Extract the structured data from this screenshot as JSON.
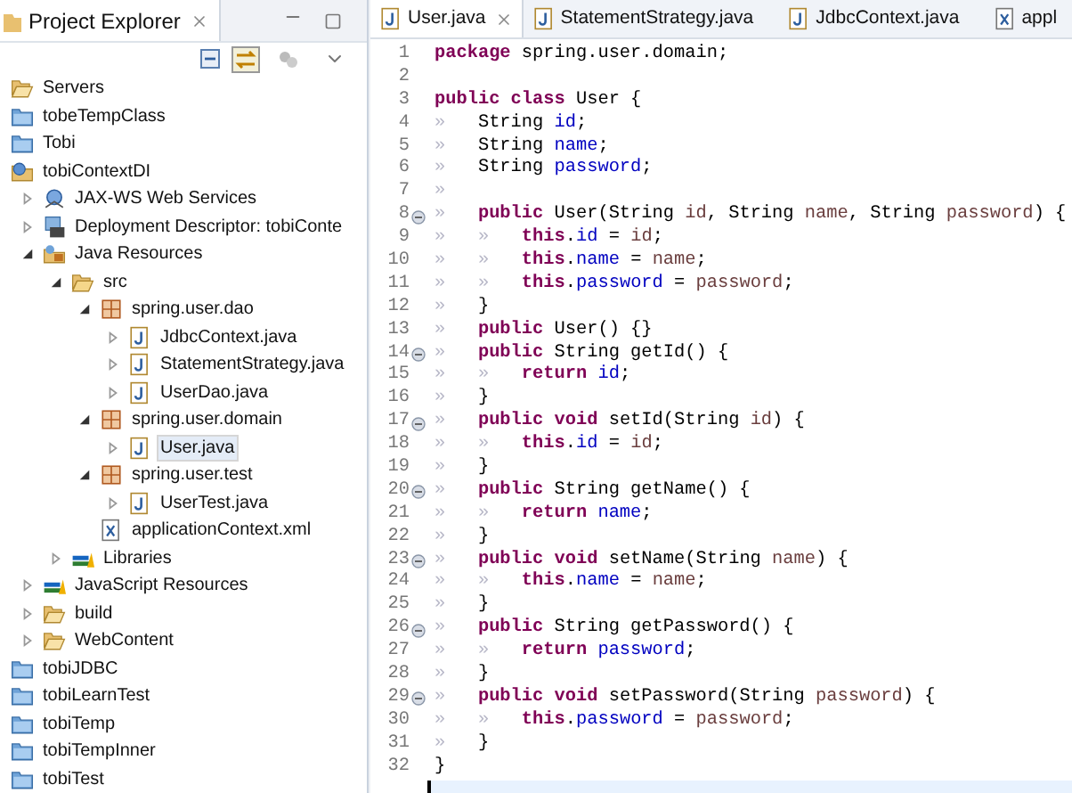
{
  "explorer": {
    "title": "Project Explorer",
    "tree": [
      {
        "label": "Servers",
        "kind": "open-folder"
      },
      {
        "label": "tobeTempClass",
        "kind": "project"
      },
      {
        "label": "Tobi",
        "kind": "project"
      },
      {
        "label": "tobiContextDI",
        "kind": "web-project",
        "children": [
          {
            "label": "JAX-WS Web Services",
            "kind": "web-services",
            "expanded": false
          },
          {
            "label": "Deployment Descriptor: tobiConte",
            "kind": "descriptor",
            "expanded": false
          },
          {
            "label": "Java Resources",
            "kind": "java-resources",
            "expanded": true,
            "children": [
              {
                "label": "src",
                "kind": "source-folder",
                "expanded": true,
                "children": [
                  {
                    "label": "spring.user.dao",
                    "kind": "package",
                    "expanded": true,
                    "children": [
                      {
                        "label": "JdbcContext.java",
                        "kind": "java",
                        "expanded": false,
                        "selected": false
                      },
                      {
                        "label": "StatementStrategy.java",
                        "kind": "java",
                        "expanded": false,
                        "selected": false
                      },
                      {
                        "label": "UserDao.java",
                        "kind": "java",
                        "expanded": false,
                        "selected": false
                      }
                    ]
                  },
                  {
                    "label": "spring.user.domain",
                    "kind": "package",
                    "expanded": true,
                    "children": [
                      {
                        "label": "User.java",
                        "kind": "java",
                        "expanded": false,
                        "selected": true
                      }
                    ]
                  },
                  {
                    "label": "spring.user.test",
                    "kind": "package",
                    "expanded": true,
                    "children": [
                      {
                        "label": "UserTest.java",
                        "kind": "java",
                        "expanded": false,
                        "selected": false
                      }
                    ]
                  },
                  {
                    "label": "applicationContext.xml",
                    "kind": "xml"
                  }
                ]
              },
              {
                "label": "Libraries",
                "kind": "library",
                "expanded": false
              }
            ]
          },
          {
            "label": "JavaScript Resources",
            "kind": "library",
            "expanded": false
          },
          {
            "label": "build",
            "kind": "open-folder",
            "expanded": false
          },
          {
            "label": "WebContent",
            "kind": "open-folder",
            "expanded": false
          }
        ]
      },
      {
        "label": "tobiJDBC",
        "kind": "project"
      },
      {
        "label": "tobiLearnTest",
        "kind": "project"
      },
      {
        "label": "tobiTemp",
        "kind": "project"
      },
      {
        "label": "tobiTempInner",
        "kind": "project"
      },
      {
        "label": "tobiTest",
        "kind": "project"
      }
    ]
  },
  "editor": {
    "tabs": [
      {
        "label": "User.java",
        "kind": "java",
        "selected": true
      },
      {
        "label": "StatementStrategy.java",
        "kind": "java",
        "selected": false
      },
      {
        "label": "JdbcContext.java",
        "kind": "java",
        "selected": false
      },
      {
        "label": "appl",
        "kind": "xml",
        "selected": false
      }
    ],
    "lines": [
      {
        "number": "1",
        "fold": false,
        "tokens": [
          {
            "kind": "keyword",
            "text": "package"
          },
          {
            "kind": "plain",
            "text": " spring.user.domain;"
          }
        ]
      },
      {
        "number": "2",
        "fold": false
      },
      {
        "number": "3",
        "fold": false,
        "tokens": [
          {
            "kind": "keyword",
            "text": "public"
          },
          {
            "kind": "keyword",
            "text": " class"
          },
          {
            "kind": "plain",
            "text": " User {"
          }
        ]
      },
      {
        "number": "4",
        "tabs": [
          "»"
        ],
        "fold": false,
        "tokens": [
          {
            "kind": "plain",
            "text": "String "
          },
          {
            "kind": "field",
            "text": "id"
          },
          {
            "kind": "plain",
            "text": ";"
          }
        ]
      },
      {
        "number": "5",
        "tabs": [
          "»"
        ],
        "fold": false,
        "tokens": [
          {
            "kind": "plain",
            "text": "String "
          },
          {
            "kind": "field",
            "text": "name"
          },
          {
            "kind": "plain",
            "text": ";"
          }
        ]
      },
      {
        "number": "6",
        "tabs": [
          "»"
        ],
        "fold": false,
        "tokens": [
          {
            "kind": "plain",
            "text": "String "
          },
          {
            "kind": "field",
            "text": "password"
          },
          {
            "kind": "plain",
            "text": ";"
          }
        ]
      },
      {
        "number": "7",
        "tabs": [
          "»"
        ],
        "fold": false
      },
      {
        "number": "8",
        "tabs": [
          "»"
        ],
        "fold": true,
        "tokens": [
          {
            "kind": "keyword",
            "text": "public"
          },
          {
            "kind": "plain",
            "text": " User(String "
          },
          {
            "kind": "param",
            "text": "id"
          },
          {
            "kind": "plain",
            "text": ", String "
          },
          {
            "kind": "param",
            "text": "name"
          },
          {
            "kind": "plain",
            "text": ", String "
          },
          {
            "kind": "param",
            "text": "password"
          },
          {
            "kind": "plain",
            "text": ") {"
          }
        ]
      },
      {
        "number": "9",
        "tabs": [
          "»",
          "»"
        ],
        "fold": false,
        "tokens": [
          {
            "kind": "keyword",
            "text": "this"
          },
          {
            "kind": "plain",
            "text": "."
          },
          {
            "kind": "field",
            "text": "id"
          },
          {
            "kind": "plain",
            "text": " = "
          },
          {
            "kind": "param",
            "text": "id"
          },
          {
            "kind": "plain",
            "text": ";"
          }
        ]
      },
      {
        "number": "10",
        "tabs": [
          "»",
          "»"
        ],
        "fold": false,
        "tokens": [
          {
            "kind": "keyword",
            "text": "this"
          },
          {
            "kind": "plain",
            "text": "."
          },
          {
            "kind": "field",
            "text": "name"
          },
          {
            "kind": "plain",
            "text": " = "
          },
          {
            "kind": "param",
            "text": "name"
          },
          {
            "kind": "plain",
            "text": ";"
          }
        ]
      },
      {
        "number": "11",
        "tabs": [
          "»",
          "»"
        ],
        "fold": false,
        "tokens": [
          {
            "kind": "keyword",
            "text": "this"
          },
          {
            "kind": "plain",
            "text": "."
          },
          {
            "kind": "field",
            "text": "password"
          },
          {
            "kind": "plain",
            "text": " = "
          },
          {
            "kind": "param",
            "text": "password"
          },
          {
            "kind": "plain",
            "text": ";"
          }
        ]
      },
      {
        "number": "12",
        "tabs": [
          "»"
        ],
        "fold": false,
        "tokens": [
          {
            "kind": "plain",
            "text": "}"
          }
        ]
      },
      {
        "number": "13",
        "tabs": [
          "»"
        ],
        "fold": false,
        "tokens": [
          {
            "kind": "keyword",
            "text": "public"
          },
          {
            "kind": "plain",
            "text": " User() {}"
          }
        ]
      },
      {
        "number": "14",
        "tabs": [
          "»"
        ],
        "fold": true,
        "tokens": [
          {
            "kind": "keyword",
            "text": "public"
          },
          {
            "kind": "plain",
            "text": " String getId() {"
          }
        ]
      },
      {
        "number": "15",
        "tabs": [
          "»",
          "»"
        ],
        "fold": false,
        "tokens": [
          {
            "kind": "keyword",
            "text": "return"
          },
          {
            "kind": "field",
            "text": " id"
          },
          {
            "kind": "plain",
            "text": ";"
          }
        ]
      },
      {
        "number": "16",
        "tabs": [
          "»"
        ],
        "fold": false,
        "tokens": [
          {
            "kind": "plain",
            "text": "}"
          }
        ]
      },
      {
        "number": "17",
        "tabs": [
          "»"
        ],
        "fold": true,
        "tokens": [
          {
            "kind": "keyword",
            "text": "public"
          },
          {
            "kind": "keyword",
            "text": " void"
          },
          {
            "kind": "plain",
            "text": " setId(String "
          },
          {
            "kind": "param",
            "text": "id"
          },
          {
            "kind": "plain",
            "text": ") {"
          }
        ]
      },
      {
        "number": "18",
        "tabs": [
          "»",
          "»"
        ],
        "fold": false,
        "tokens": [
          {
            "kind": "keyword",
            "text": "this"
          },
          {
            "kind": "plain",
            "text": "."
          },
          {
            "kind": "field",
            "text": "id"
          },
          {
            "kind": "plain",
            "text": " = "
          },
          {
            "kind": "param",
            "text": "id"
          },
          {
            "kind": "plain",
            "text": ";"
          }
        ]
      },
      {
        "number": "19",
        "tabs": [
          "»"
        ],
        "fold": false,
        "tokens": [
          {
            "kind": "plain",
            "text": "}"
          }
        ]
      },
      {
        "number": "20",
        "tabs": [
          "»"
        ],
        "fold": true,
        "tokens": [
          {
            "kind": "keyword",
            "text": "public"
          },
          {
            "kind": "plain",
            "text": " String getName() {"
          }
        ]
      },
      {
        "number": "21",
        "tabs": [
          "»",
          "»"
        ],
        "fold": false,
        "tokens": [
          {
            "kind": "keyword",
            "text": "return"
          },
          {
            "kind": "field",
            "text": " name"
          },
          {
            "kind": "plain",
            "text": ";"
          }
        ]
      },
      {
        "number": "22",
        "tabs": [
          "»"
        ],
        "fold": false,
        "tokens": [
          {
            "kind": "plain",
            "text": "}"
          }
        ]
      },
      {
        "number": "23",
        "tabs": [
          "»"
        ],
        "fold": true,
        "tokens": [
          {
            "kind": "keyword",
            "text": "public"
          },
          {
            "kind": "keyword",
            "text": " void"
          },
          {
            "kind": "plain",
            "text": " setName(String "
          },
          {
            "kind": "param",
            "text": "name"
          },
          {
            "kind": "plain",
            "text": ") {"
          }
        ]
      },
      {
        "number": "24",
        "tabs": [
          "»",
          "»"
        ],
        "fold": false,
        "tokens": [
          {
            "kind": "keyword",
            "text": "this"
          },
          {
            "kind": "plain",
            "text": "."
          },
          {
            "kind": "field",
            "text": "name"
          },
          {
            "kind": "plain",
            "text": " = "
          },
          {
            "kind": "param",
            "text": "name"
          },
          {
            "kind": "plain",
            "text": ";"
          }
        ]
      },
      {
        "number": "25",
        "tabs": [
          "»"
        ],
        "fold": false,
        "tokens": [
          {
            "kind": "plain",
            "text": "}"
          }
        ]
      },
      {
        "number": "26",
        "tabs": [
          "»"
        ],
        "fold": true,
        "tokens": [
          {
            "kind": "keyword",
            "text": "public"
          },
          {
            "kind": "plain",
            "text": " String getPassword() {"
          }
        ]
      },
      {
        "number": "27",
        "tabs": [
          "»",
          "»"
        ],
        "fold": false,
        "tokens": [
          {
            "kind": "keyword",
            "text": "return"
          },
          {
            "kind": "field",
            "text": " password"
          },
          {
            "kind": "plain",
            "text": ";"
          }
        ]
      },
      {
        "number": "28",
        "tabs": [
          "»"
        ],
        "fold": false,
        "tokens": [
          {
            "kind": "plain",
            "text": "}"
          }
        ]
      },
      {
        "number": "29",
        "tabs": [
          "»"
        ],
        "fold": true,
        "tokens": [
          {
            "kind": "keyword",
            "text": "public"
          },
          {
            "kind": "keyword",
            "text": " void"
          },
          {
            "kind": "plain",
            "text": " setPassword(String "
          },
          {
            "kind": "param",
            "text": "password"
          },
          {
            "kind": "plain",
            "text": ") {"
          }
        ]
      },
      {
        "number": "30",
        "tabs": [
          "»",
          "»"
        ],
        "fold": false,
        "tokens": [
          {
            "kind": "keyword",
            "text": "this"
          },
          {
            "kind": "plain",
            "text": "."
          },
          {
            "kind": "field",
            "text": "password"
          },
          {
            "kind": "plain",
            "text": " = "
          },
          {
            "kind": "param",
            "text": "password"
          },
          {
            "kind": "plain",
            "text": ";"
          }
        ]
      },
      {
        "number": "31",
        "tabs": [
          "»"
        ],
        "fold": false,
        "tokens": [
          {
            "kind": "plain",
            "text": "}"
          }
        ]
      },
      {
        "number": "32",
        "fold": false,
        "tokens": [
          {
            "kind": "plain",
            "text": "}"
          }
        ]
      }
    ]
  }
}
